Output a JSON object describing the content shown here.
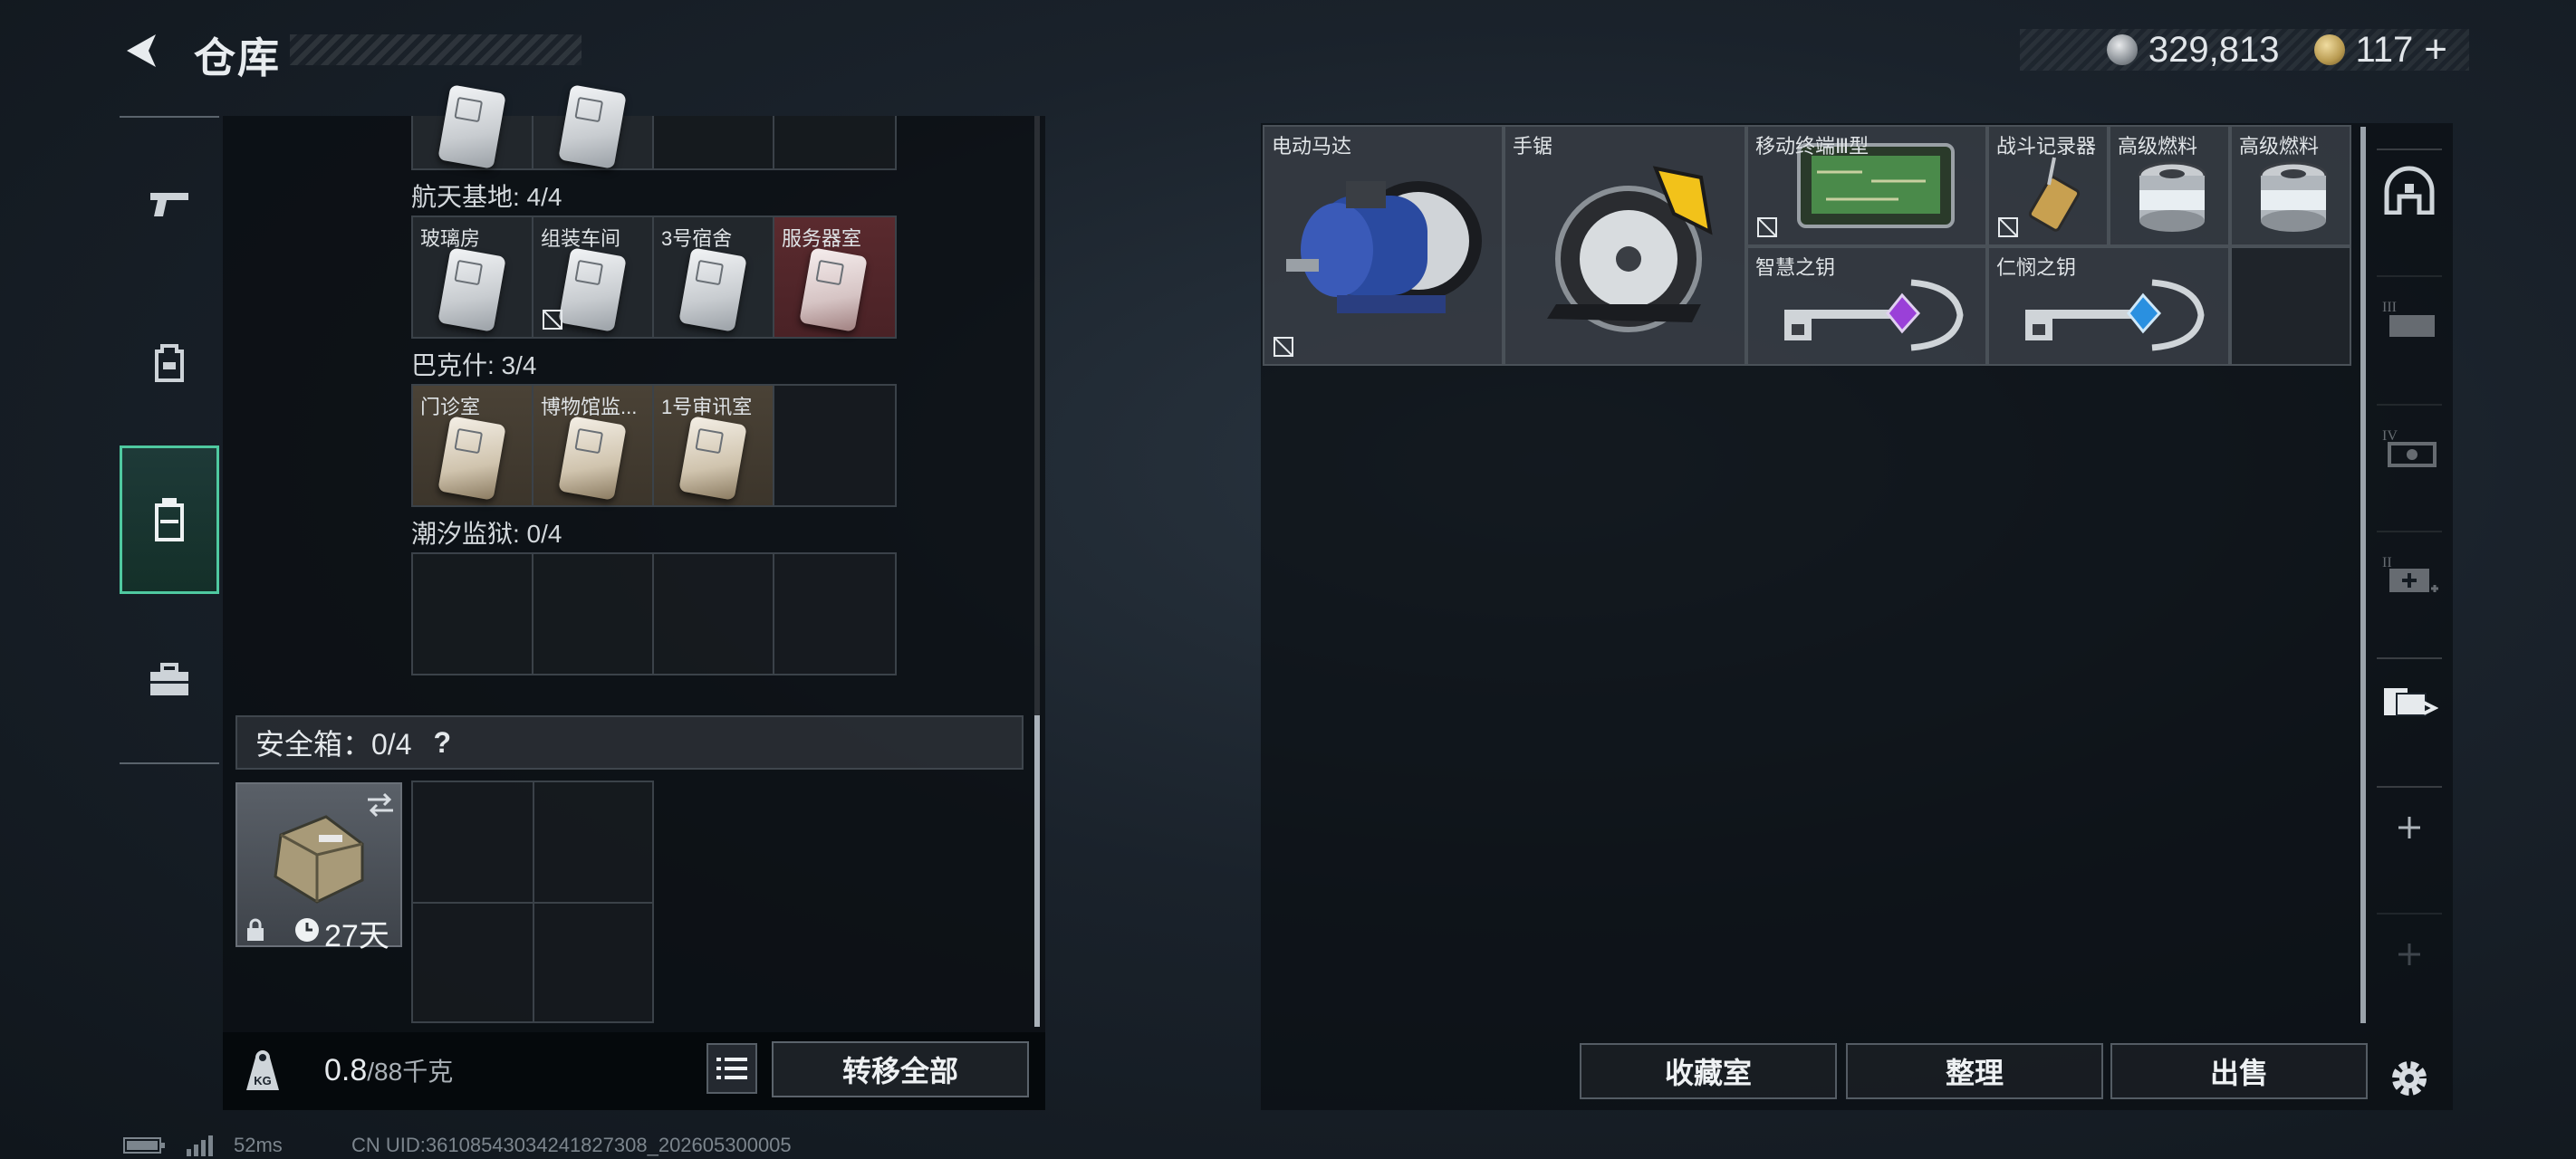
{
  "header": {
    "title": "仓库",
    "currency_silver": "329,813",
    "currency_gold": "117",
    "gold_plus": "+"
  },
  "left_rail": {
    "items": [
      "pistol",
      "backpack",
      "case",
      "toolbox"
    ],
    "active_index": 2
  },
  "inventory": {
    "top_row_partial": [
      "",
      "",
      "",
      ""
    ],
    "sections": [
      {
        "label": "航天基地: 4/4",
        "cells": [
          {
            "label": "玻璃房",
            "tone": "grey",
            "no_sell": false
          },
          {
            "label": "组装车间",
            "tone": "grey",
            "no_sell": true
          },
          {
            "label": "3号宿舍",
            "tone": "grey",
            "no_sell": false
          },
          {
            "label": "服务器室",
            "tone": "red",
            "no_sell": false
          }
        ]
      },
      {
        "label": "巴克什: 3/4",
        "cells": [
          {
            "label": "门诊室",
            "tone": "brown",
            "no_sell": false
          },
          {
            "label": "博物馆监...",
            "tone": "brown",
            "no_sell": false
          },
          {
            "label": "1号审讯室",
            "tone": "brown",
            "no_sell": false
          },
          {
            "label": "",
            "tone": "empty",
            "no_sell": false
          }
        ]
      },
      {
        "label": "潮汐监狱: 0/4",
        "cells": [
          {
            "label": "",
            "tone": "empty"
          },
          {
            "label": "",
            "tone": "empty"
          },
          {
            "label": "",
            "tone": "empty"
          },
          {
            "label": "",
            "tone": "empty"
          }
        ]
      }
    ],
    "safe": {
      "label": "安全箱：0/4",
      "help": "?",
      "duration": "27天"
    },
    "weight": {
      "current": "0.8",
      "max": "/88千克",
      "icon_text": "KG"
    },
    "transfer_all": "转移全部"
  },
  "storage": {
    "items": [
      {
        "label": "电动马达"
      },
      {
        "label": "手锯"
      },
      {
        "label": "移动终端Ⅲ型"
      },
      {
        "label": "战斗记录器"
      },
      {
        "label": "高级燃料"
      },
      {
        "label": "高级燃料"
      },
      {
        "label": "智慧之钥"
      },
      {
        "label": "仁悯之钥"
      }
    ],
    "buttons": {
      "collection": "收藏室",
      "sort": "整理",
      "sell": "出售"
    }
  },
  "right_rail": {
    "items": [
      "storage-room",
      "tier-3-case",
      "tier-4-case",
      "tier-2-medkit",
      "keycard-storage",
      "add",
      "add-dim",
      "settings"
    ]
  },
  "status": {
    "ping": "52ms",
    "uid": "CN UID:3610854303424182730​8_202605300005"
  }
}
